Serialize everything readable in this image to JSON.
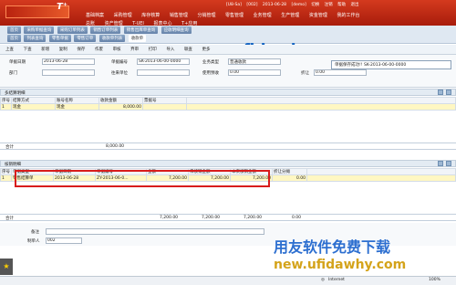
{
  "topbar": {
    "info": [
      "[U8-Sa]",
      "[002]",
      "2013-06-28",
      "[demo]"
    ],
    "links": [
      "切换",
      "注销",
      "帮助",
      "退出"
    ],
    "menu_row1": [
      "基础档案",
      "采购管理",
      "库存核算",
      "销售管理",
      "分销管理",
      "零售管理",
      "业务管理",
      "生产管理",
      "资金管理",
      "我的工作台"
    ],
    "menu_row2": [
      "总账",
      "资产管理",
      "T-UEI",
      "报表中心",
      "T+应用"
    ]
  },
  "tabs": {
    "row1": [
      "首页",
      "采购单据查询",
      "采购订单列表",
      "销售订单列表",
      "销售出库单查询",
      "应收明细查询"
    ],
    "row2": [
      "首页",
      "列表查询",
      "零售单据",
      "零售订单",
      "收款单列表",
      "收款单"
    ]
  },
  "toolbar": [
    "上查",
    "下查",
    "新增",
    "复制",
    "保存",
    "作废",
    "审核",
    "弃审",
    "打印",
    "导入",
    "联查",
    "更多"
  ],
  "header": {
    "date_label": "单据日期",
    "date_value": "2013-06-28",
    "no_label": "单据编号",
    "no_value": "SK-2013-06-00-0000",
    "type_label": "业务类型",
    "type_value": "普通收款",
    "dept_label": "部门",
    "customer_label": "往来单位",
    "advance_label": "使用预收",
    "advance_value": "0.00",
    "discount_label": "折让",
    "discount_value": "0.00"
  },
  "popup_text": "单据保存成功!! SK-2013-06-00-0000",
  "settle": {
    "title": "多结算明细",
    "columns": [
      "序号",
      "结算方式",
      "账号名称",
      "收款金额",
      "票据号"
    ],
    "rows": [
      [
        "1",
        "现金",
        "现金",
        "8,000.00",
        ""
      ]
    ],
    "total_label": "合计",
    "total_value": "8,000.00"
  },
  "writeoff": {
    "title": "核销明细",
    "columns": [
      "序号",
      "单据类型",
      "单据日期",
      "单据编号",
      "金额",
      "未核销金额",
      "本次核销金额",
      "折让分摊"
    ],
    "rows": [
      [
        "1",
        "零售结算单",
        "2013-06-28",
        "ZY-2013-06-0...",
        "7,200.00",
        "7,200.00",
        "7,200.00",
        "0.00"
      ]
    ],
    "total_label": "合计",
    "total_values": [
      "7,200.00",
      "7,200.00",
      "7,200.00",
      "0.00"
    ]
  },
  "footer": {
    "remark_label": "备注",
    "maker_label": "制单人",
    "maker_value": "002"
  },
  "watermarks": {
    "top": "new.ufidawhy.com",
    "mid": "用友软件免费下载",
    "bottom": "new.ufidawhy.com"
  },
  "status": {
    "zone": "Internet",
    "zoom": "100%"
  }
}
